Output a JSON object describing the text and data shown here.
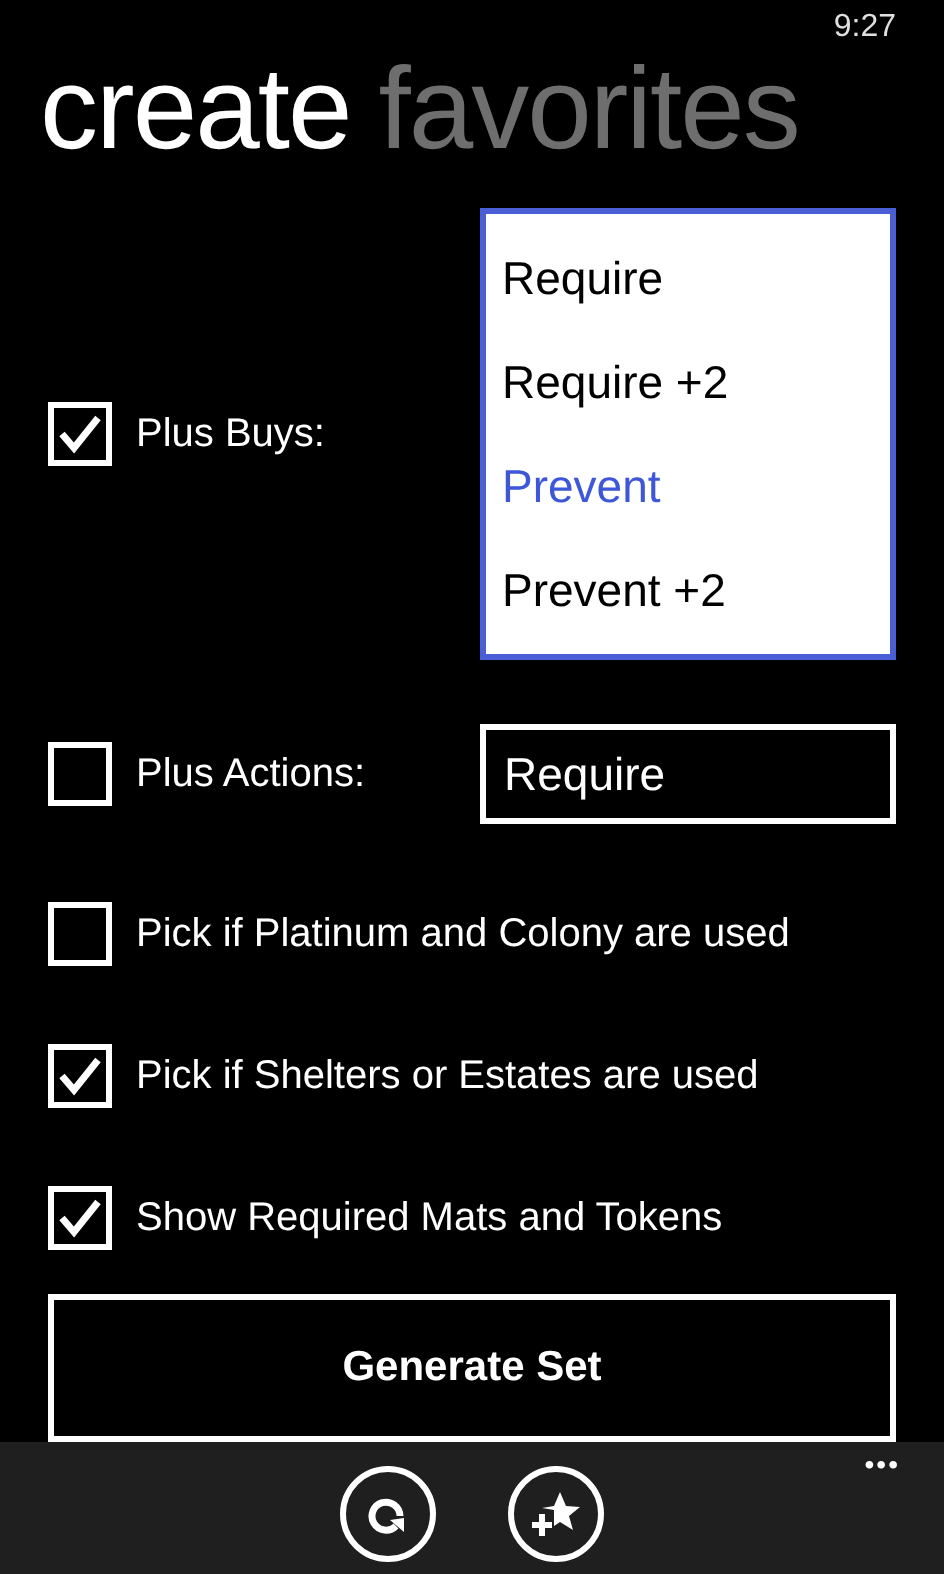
{
  "status_bar": {
    "time": "9:27"
  },
  "pivots": [
    {
      "label": "create",
      "selected": true
    },
    {
      "label": "favorites",
      "selected": false
    }
  ],
  "options": [
    {
      "kind": "picker",
      "label": "Plus Buys:",
      "checked": true,
      "picker": {
        "expanded": true,
        "items": [
          {
            "label": "Require",
            "selected": false
          },
          {
            "label": "Require +2",
            "selected": false
          },
          {
            "label": "Prevent",
            "selected": true
          },
          {
            "label": "Prevent +2",
            "selected": false
          }
        ]
      }
    },
    {
      "kind": "picker",
      "label": "Plus Actions:",
      "checked": false,
      "picker": {
        "expanded": false,
        "value": "Require"
      }
    },
    {
      "kind": "check",
      "label": "Pick if Platinum and Colony are used",
      "checked": false
    },
    {
      "kind": "check",
      "label": "Pick if Shelters or Estates are used",
      "checked": true
    },
    {
      "kind": "check",
      "label": "Show Required Mats and Tokens",
      "checked": true
    }
  ],
  "generate_button": "Generate Set",
  "app_bar": {
    "buttons": [
      {
        "kind": "refresh"
      },
      {
        "kind": "add-favorite"
      }
    ],
    "more": "•••"
  }
}
